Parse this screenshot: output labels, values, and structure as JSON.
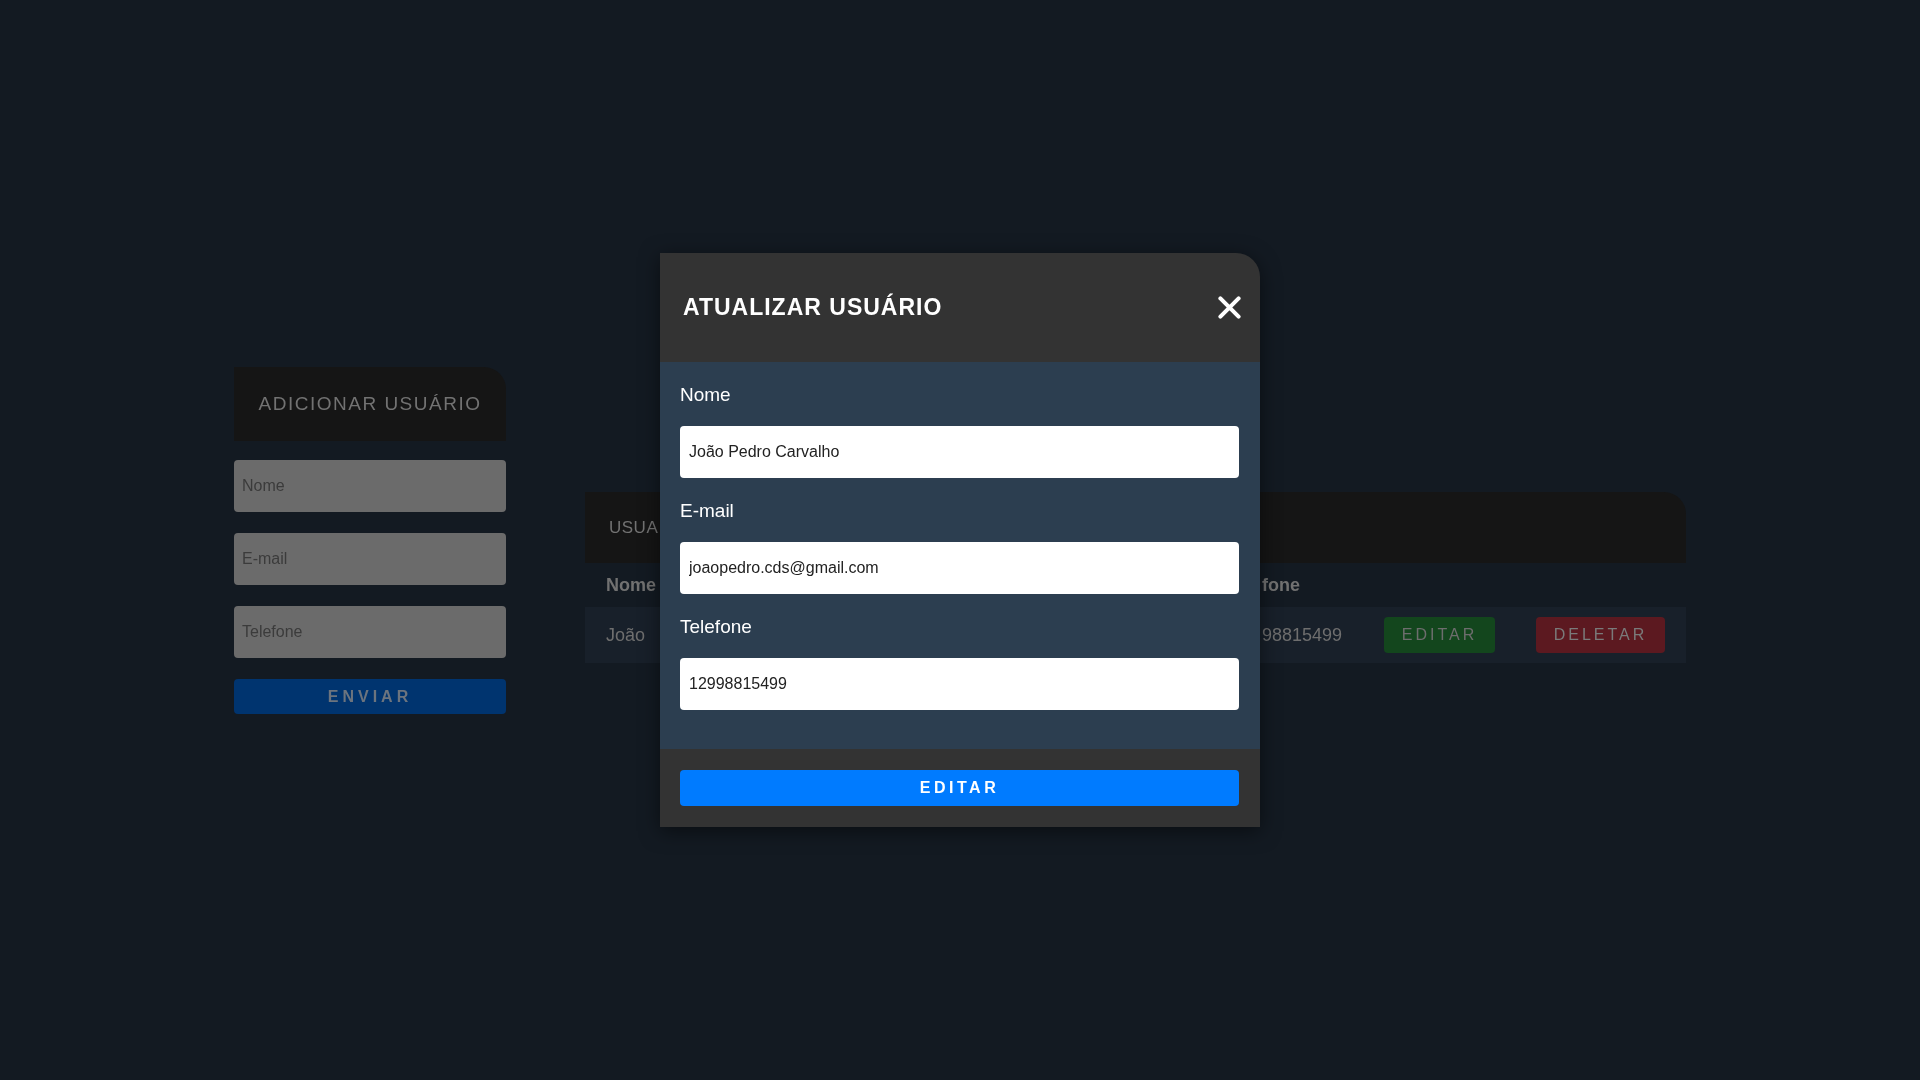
{
  "add_user_form": {
    "title": "ADICIONAR USUÁRIO",
    "fields": [
      {
        "placeholder": "Nome"
      },
      {
        "placeholder": "E-mail"
      },
      {
        "placeholder": "Telefone"
      }
    ],
    "submit_button": "ENVIAR"
  },
  "users_table": {
    "title": "USUA",
    "columns": [
      "Nome",
      "fone"
    ],
    "rows": [
      {
        "cells": [
          "João",
          "98815499"
        ],
        "actions": [
          {
            "kind": "edit",
            "label": "EDITAR"
          },
          {
            "kind": "delete",
            "label": "DELETAR"
          }
        ]
      }
    ]
  },
  "modal": {
    "title": "ATUALIZAR USUÁRIO",
    "fields": [
      {
        "label": "Nome",
        "value": "João Pedro Carvalho"
      },
      {
        "label": "E-mail",
        "value": "joaopedro.cds@gmail.com"
      },
      {
        "label": "Telefone",
        "value": "12998815499"
      }
    ],
    "submit_button": "EDITAR"
  }
}
